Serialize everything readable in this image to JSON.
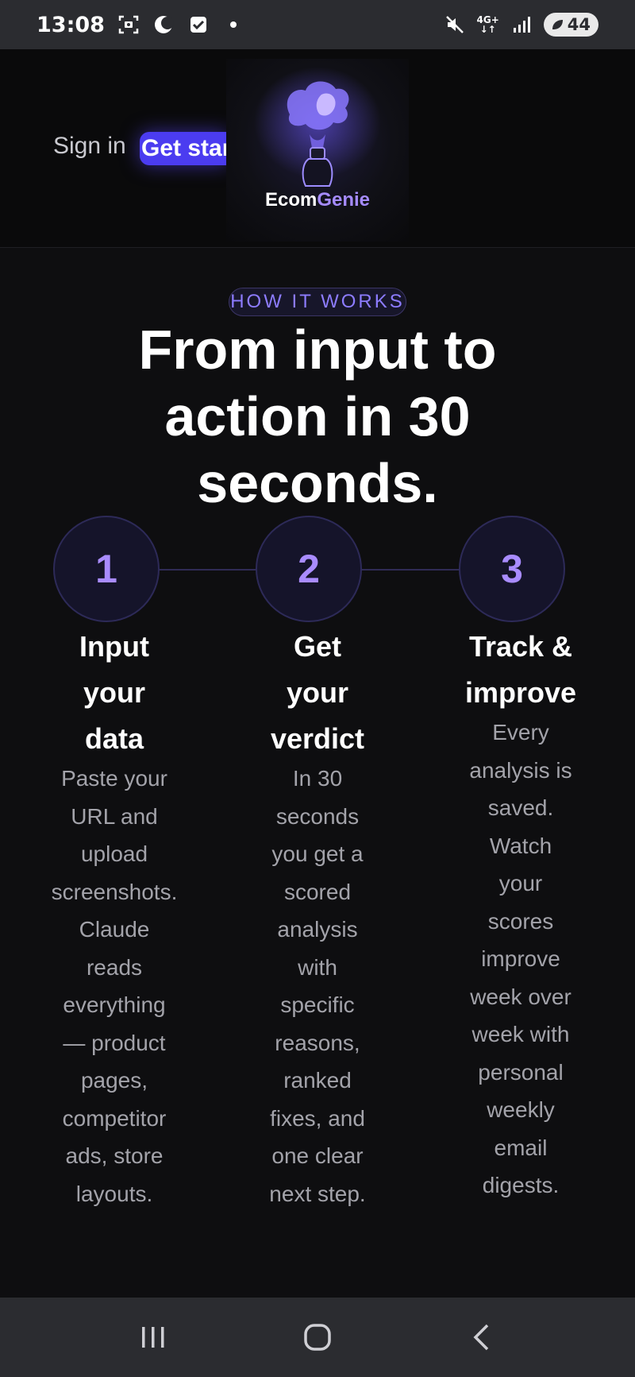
{
  "status_bar": {
    "time": "13:08",
    "network": "4G+",
    "battery": "44"
  },
  "header": {
    "signin_label": "Sign in",
    "getstarted_label": "Get started",
    "logo": {
      "brand_part1": "Ecom",
      "brand_part2": "Genie",
      "brand_color": "#a58bff"
    }
  },
  "how_it_works": {
    "eyebrow": "HOW IT WORKS",
    "headline_line1": "From input to",
    "headline_line2": "action in 30",
    "headline_line3": "seconds.",
    "steps": [
      {
        "number": "1",
        "title_lines": [
          "Input",
          "your",
          "data"
        ],
        "desc_lines": [
          "Paste your",
          "URL and",
          "upload",
          "screenshots.",
          "Claude",
          "reads",
          "everything",
          "— product",
          "pages,",
          "competitor",
          "ads, store",
          "layouts."
        ]
      },
      {
        "number": "2",
        "title_lines": [
          "Get",
          "your",
          "verdict"
        ],
        "desc_lines": [
          "In 30",
          "seconds",
          "you get a",
          "scored",
          "analysis",
          "with",
          "specific",
          "reasons,",
          "ranked",
          "fixes, and",
          "one clear",
          "next step."
        ]
      },
      {
        "number": "3",
        "title_lines": [
          "Track &",
          "improve"
        ],
        "desc_lines": [
          "Every",
          "analysis is",
          "saved.",
          "Watch",
          "your",
          "scores",
          "improve",
          "week over",
          "week with",
          "personal",
          "weekly",
          "email",
          "digests."
        ]
      }
    ]
  },
  "colors": {
    "accent": "#4b3cf0",
    "step_number": "#a98cff",
    "background": "#0e0e10"
  }
}
